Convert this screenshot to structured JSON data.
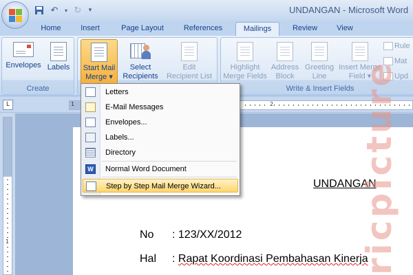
{
  "window": {
    "title": "UNDANGAN - Microsoft Word"
  },
  "tabs": [
    {
      "label": "Home"
    },
    {
      "label": "Insert"
    },
    {
      "label": "Page Layout"
    },
    {
      "label": "References"
    },
    {
      "label": "Mailings",
      "active": true
    },
    {
      "label": "Review"
    },
    {
      "label": "View"
    }
  ],
  "ribbon": {
    "create": {
      "label": "Create",
      "envelopes": "Envelopes",
      "labels": "Labels"
    },
    "start": {
      "start_mail_merge_line1": "Start Mail",
      "start_mail_merge_line2": "Merge ▾",
      "select_recipients_line1": "Select",
      "select_recipients_line2": "Recipients ▾",
      "edit_list_line1": "Edit",
      "edit_list_line2": "Recipient List"
    },
    "write_insert": {
      "label": "Write & Insert Fields",
      "highlight_line1": "Highlight",
      "highlight_line2": "Merge Fields",
      "address_line1": "Address",
      "address_line2": "Block",
      "greeting_line1": "Greeting",
      "greeting_line2": "Line",
      "insert_field_line1": "Insert Merge",
      "insert_field_line2": "Field ▾",
      "rules": "Rule",
      "match": "Mat",
      "update": "Upd"
    }
  },
  "ruler": {
    "tab_marker": "L",
    "h_num_1": "1",
    "h_num_2": "2",
    "v_num_1": "1"
  },
  "menu": {
    "items": [
      {
        "label": "Letters"
      },
      {
        "label": "E-Mail Messages"
      },
      {
        "label": "Envelopes..."
      },
      {
        "label": "Labels..."
      },
      {
        "label": "Directory"
      },
      {
        "label": "Normal Word Document"
      },
      {
        "label": "Step by Step Mail Merge Wizard...",
        "highlighted": true
      }
    ]
  },
  "document": {
    "heading": "UNDANGAN",
    "no_label": "No",
    "no_value": ": 123/XX/2012",
    "hal_label": "Hal",
    "hal_value_prefix": ": ",
    "hal_value": "Rapat Koordinasi Pembahasan Kinerja"
  },
  "watermark": {
    "text": "ricpicture"
  },
  "colors": {
    "accent": "#15428b",
    "ribbon_bg": "#dbe7f6",
    "highlight": "#ffd56d",
    "pressed": "#f7b03a"
  }
}
